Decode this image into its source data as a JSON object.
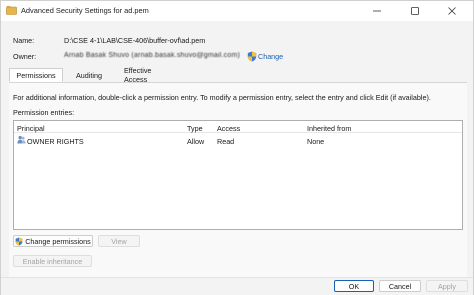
{
  "window": {
    "title": "Advanced Security Settings for ad.pem"
  },
  "fields": {
    "name_label": "Name:",
    "name_value": "D:\\CSE 4-1\\LAB\\CSE-406\\buffer-ovf\\ad.pem",
    "owner_label": "Owner:",
    "owner_value": "Arnab Basak Shuvo (arnab.basak.shuvo@gmail.com)",
    "change_link": "Change"
  },
  "tabs": [
    {
      "label": "Permissions",
      "active": true
    },
    {
      "label": "Auditing",
      "active": false
    },
    {
      "label": "Effective Access",
      "active": false
    }
  ],
  "instructions": "For additional information, double-click a permission entry. To modify a permission entry, select the entry and click Edit (if available).",
  "entries_label": "Permission entries:",
  "table": {
    "headers": [
      "Principal",
      "Type",
      "Access",
      "Inherited from"
    ],
    "rows": [
      [
        "OWNER RIGHTS",
        "Allow",
        "Read",
        "None"
      ]
    ]
  },
  "buttons": {
    "change_permissions": "Change permissions",
    "view": "View",
    "enable_inheritance": "Enable inheritance",
    "ok": "OK",
    "cancel": "Cancel",
    "apply": "Apply"
  },
  "colors": {
    "link": "#1a5fb4",
    "primary_border": "#1a5fb4",
    "folder": "#e8b54a"
  },
  "icons": {
    "window": "file-shield-icon",
    "shield": "uac-shield-icon",
    "user": "user-group-icon"
  }
}
